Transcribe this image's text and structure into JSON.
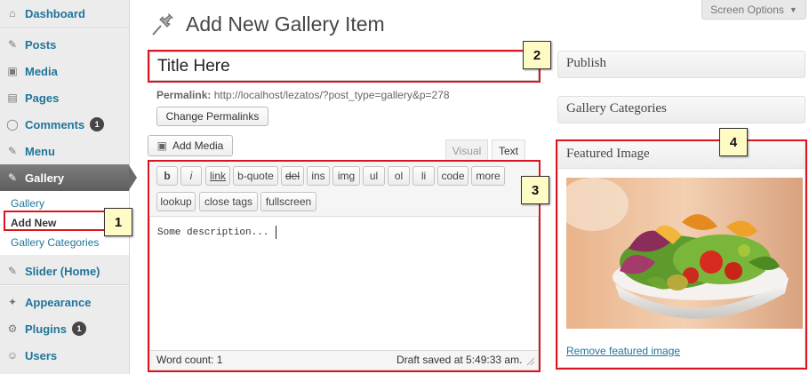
{
  "sidebar": {
    "items": [
      {
        "label": "Dashboard",
        "icon": "dashboard-icon"
      },
      {
        "label": "Posts",
        "icon": "pin-icon"
      },
      {
        "label": "Media",
        "icon": "media-icon"
      },
      {
        "label": "Pages",
        "icon": "pages-icon"
      },
      {
        "label": "Comments",
        "icon": "comments-icon",
        "badge": "1"
      },
      {
        "label": "Menu",
        "icon": "pin-icon"
      },
      {
        "label": "Gallery",
        "icon": "pin-icon"
      },
      {
        "label": "Slider (Home)",
        "icon": "pin-icon"
      },
      {
        "label": "Appearance",
        "icon": "appearance-icon"
      },
      {
        "label": "Plugins",
        "icon": "plugins-icon",
        "badge": "1"
      },
      {
        "label": "Users",
        "icon": "users-icon"
      }
    ],
    "gallery_submenu": [
      "Gallery",
      "Add New",
      "Gallery Categories"
    ]
  },
  "header": {
    "title": "Add New Gallery Item",
    "screen_options": "Screen Options"
  },
  "post": {
    "title_value": "Title Here",
    "permalink_label": "Permalink:",
    "permalink_url": "http://localhost/lezatos/?post_type=gallery&p=278",
    "change_permalinks": "Change Permalinks"
  },
  "editor": {
    "add_media": "Add Media",
    "tab_visual": "Visual",
    "tab_text": "Text",
    "buttons_row1": [
      "b",
      "i",
      "link",
      "b-quote",
      "del",
      "ins",
      "img",
      "ul",
      "ol",
      "li",
      "code",
      "more"
    ],
    "buttons_row2": [
      "lookup",
      "close tags",
      "fullscreen"
    ],
    "content": "Some description...",
    "word_count": "Word count: 1",
    "draft_saved": "Draft saved at 5:49:33 am."
  },
  "boxes": {
    "publish": "Publish",
    "gallery_categories": "Gallery Categories",
    "featured_image": "Featured Image",
    "remove_featured": "Remove featured image"
  },
  "callouts": [
    "1",
    "2",
    "3",
    "4"
  ],
  "colors": {
    "link": "#21759b",
    "callout_border": "#d9161f",
    "callout_fill": "#fffbc4"
  }
}
